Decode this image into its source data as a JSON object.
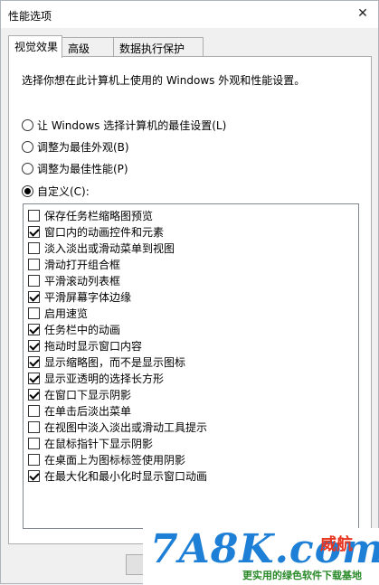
{
  "window": {
    "title": "性能选项"
  },
  "tabs": [
    {
      "label": "视觉效果",
      "active": true
    },
    {
      "label": "高级",
      "active": false
    },
    {
      "label": "数据执行保护",
      "active": false
    }
  ],
  "description": "选择你想在此计算机上使用的 Windows 外观和性能设置。",
  "radios": [
    {
      "label": "让 Windows 选择计算机的最佳设置(L)",
      "selected": false
    },
    {
      "label": "调整为最佳外观(B)",
      "selected": false
    },
    {
      "label": "调整为最佳性能(P)",
      "selected": false
    },
    {
      "label": "自定义(C):",
      "selected": true
    }
  ],
  "options": [
    {
      "label": "保存任务栏缩略图预览",
      "checked": false
    },
    {
      "label": "窗口内的动画控件和元素",
      "checked": true
    },
    {
      "label": "淡入淡出或滑动菜单到视图",
      "checked": false
    },
    {
      "label": "滑动打开组合框",
      "checked": false
    },
    {
      "label": "平滑滚动列表框",
      "checked": false
    },
    {
      "label": "平滑屏幕字体边缘",
      "checked": true
    },
    {
      "label": "启用速览",
      "checked": false
    },
    {
      "label": "任务栏中的动画",
      "checked": true
    },
    {
      "label": "拖动时显示窗口内容",
      "checked": true
    },
    {
      "label": "显示缩略图，而不是显示图标",
      "checked": true
    },
    {
      "label": "显示亚透明的选择长方形",
      "checked": true
    },
    {
      "label": "在窗口下显示阴影",
      "checked": true
    },
    {
      "label": "在单击后淡出菜单",
      "checked": false
    },
    {
      "label": "在视图中淡入淡出或滑动工具提示",
      "checked": false
    },
    {
      "label": "在鼠标指针下显示阴影",
      "checked": false
    },
    {
      "label": "在桌面上为图标标签使用阴影",
      "checked": false
    },
    {
      "label": "在最大化和最小化时显示窗口动画",
      "checked": true
    }
  ],
  "watermark": {
    "logo": "7A8K.com",
    "cn_name": "威航",
    "slogan": "更实用的绿色软件下载基地"
  },
  "colors": {
    "accent": "#1e7fd6",
    "watermark_red": "#e8351f",
    "watermark_green": "#2a8a2a"
  }
}
